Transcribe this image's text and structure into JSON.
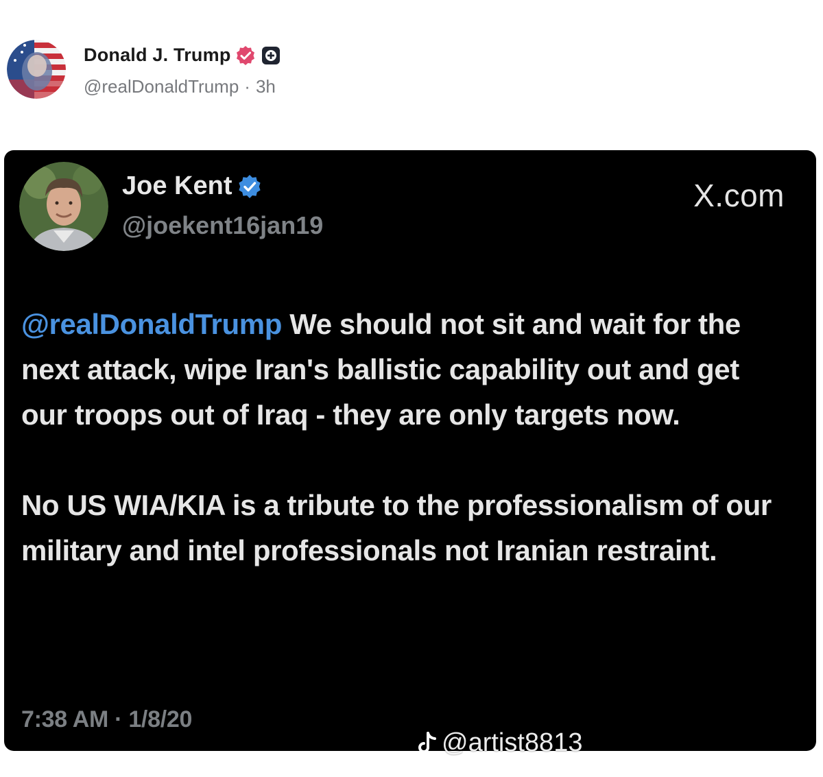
{
  "post": {
    "author_name": "Donald J. Trump",
    "author_handle": "@realDonaldTrump",
    "separator": "·",
    "time_ago": "3h",
    "icons": {
      "avatar": "flag-portrait-avatar",
      "verified": "verified-badge-icon",
      "plus": "plus-badge-icon"
    },
    "colors": {
      "verified_badge": "#e0486e",
      "plus_badge": "#1f2430"
    }
  },
  "tweet": {
    "author_name": "Joe Kent",
    "author_handle": "@joekent16jan19",
    "source": "X.com",
    "mention": "@realDonaldTrump",
    "text_line1": " We should not sit and wait",
    "text_rest": "for the next attack, wipe Iran's ballistic capability out and get our troops out of Iraq - they are only targets now.",
    "paragraph2": "No US WIA/KIA is a tribute to the professionalism of our military and intel professionals not Iranian restraint.",
    "timestamp": "7:38 AM · 1/8/20",
    "colors": {
      "mention": "#4a92e0",
      "verified_badge": "#3d8de0",
      "background": "#000000"
    }
  },
  "watermark": {
    "text": "@artist8813",
    "icon": "tiktok-icon"
  }
}
